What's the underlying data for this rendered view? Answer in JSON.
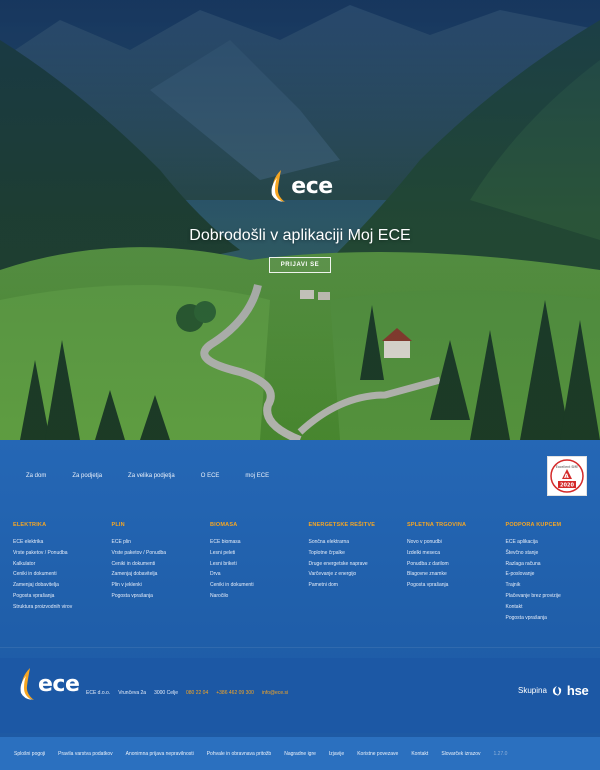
{
  "hero": {
    "logo_text": "ece",
    "title": "Dobrodošli v aplikaciji Moj ECE",
    "login_label": "PRIJAVI SE"
  },
  "topnav": [
    "Za dom",
    "Za podjetja",
    "Za velika podjetja",
    "O ECE",
    "moj ECE"
  ],
  "badge": {
    "top_text": "Excellent SME",
    "year": "2020"
  },
  "columns": [
    {
      "title": "ELEKTRIKA",
      "items": [
        "ECE elektrika",
        "Vrste paketov / Ponudba",
        "Kalkulator",
        "Ceniki in dokumenti",
        "Zamenjaj dobavitelja",
        "Pogosta vprašanja",
        "Struktura proizvodnih virov"
      ]
    },
    {
      "title": "PLIN",
      "items": [
        "ECE plin",
        "Vrste paketov / Ponudba",
        "Ceniki in dokumenti",
        "Zamenjaj dobavitelja",
        "Plin v jeklenki",
        "Pogosta vprašanja"
      ]
    },
    {
      "title": "BIOMASA",
      "items": [
        "ECE biomasa",
        "Lesni peleti",
        "Lesni briketi",
        "Drva",
        "Ceniki in dokumenti",
        "Naročilo"
      ]
    },
    {
      "title": "ENERGETSKE REŠITVE",
      "items": [
        "Sončna elektrarna",
        "Toplotne črpalke",
        "Druge energetske naprave",
        "Varčevanje z energijo",
        "Pametni dom"
      ]
    },
    {
      "title": "SPLETNA TRGOVINA",
      "items": [
        "Novo v ponudbi",
        "Izdelki meseca",
        "Ponudba z darilom",
        "Blagovne znamke",
        "Pogosta vprašanja"
      ]
    },
    {
      "title": "PODPORA KUPCEM",
      "items": [
        "ECE aplikacija",
        "Števčno stanje",
        "Razlaga računa",
        "E-poslovanje",
        "Trajnik",
        "Plačevanje brez provizije",
        "Kontakt",
        "Pogosta vprašanja"
      ]
    }
  ],
  "company": {
    "name": "ECE d.o.o.",
    "street": "Vrunčeva 2a",
    "city": "3000 Celje",
    "phone1": "080 22 04",
    "phone2": "+386 462 09 300",
    "email": "info@ece.si"
  },
  "group": {
    "prefix": "Skupina",
    "name": "hse"
  },
  "bottomnav": [
    "Splošni pogoji",
    "Pravila varstva podatkov",
    "Anonimna prijava nepravilnosti",
    "Pohvale in obravnava pritožb",
    "Nagradne igre",
    "Izjavije",
    "Koristne povezave",
    "Kontakt",
    "Slovarček izrazov"
  ],
  "version": "1.27.0",
  "colors": {
    "accent": "#f6a623",
    "brand_blue": "#1f5aa6",
    "badge_red": "#d42a2a"
  }
}
